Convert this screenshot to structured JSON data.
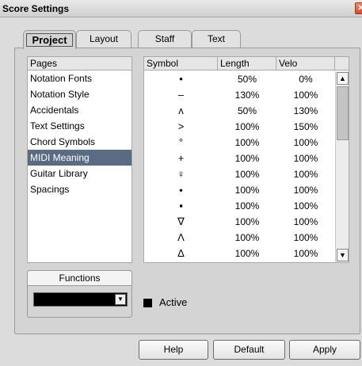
{
  "window": {
    "title": "Score Settings",
    "close_glyph": "✕"
  },
  "tabs": [
    {
      "label": "Project"
    },
    {
      "label": "Layout"
    },
    {
      "label": "Staff"
    },
    {
      "label": "Text"
    }
  ],
  "pages": {
    "header": "Pages",
    "items": [
      "Notation Fonts",
      "Notation Style",
      "Accidentals",
      "Text Settings",
      "Chord Symbols",
      "MIDI Meaning",
      "Guitar Library",
      "Spacings"
    ],
    "selected": "MIDI Meaning"
  },
  "table": {
    "headers": {
      "symbol": "Symbol",
      "length": "Length",
      "velo": "Velo"
    },
    "rows": [
      {
        "symbol": "•",
        "length": "50%",
        "velo": "0%"
      },
      {
        "symbol": "–",
        "length": "130%",
        "velo": "100%"
      },
      {
        "symbol": "ʌ",
        "length": "50%",
        "velo": "130%"
      },
      {
        "symbol": ">",
        "length": "100%",
        "velo": "150%"
      },
      {
        "symbol": "°",
        "length": "100%",
        "velo": "100%"
      },
      {
        "symbol": "+",
        "length": "100%",
        "velo": "100%"
      },
      {
        "symbol": "♀",
        "length": "100%",
        "velo": "100%"
      },
      {
        "symbol": "⬩",
        "length": "100%",
        "velo": "100%"
      },
      {
        "symbol": "▪",
        "length": "100%",
        "velo": "100%"
      },
      {
        "symbol": "∇",
        "length": "100%",
        "velo": "100%"
      },
      {
        "symbol": "Λ",
        "length": "100%",
        "velo": "100%"
      },
      {
        "symbol": "∆",
        "length": "100%",
        "velo": "100%"
      }
    ]
  },
  "scrollbar": {
    "up_glyph": "▲",
    "down_glyph": "▼"
  },
  "functions": {
    "label": "Functions",
    "selected_value": "",
    "arrow_glyph": "▼"
  },
  "active": {
    "label": "Active",
    "checked": true
  },
  "buttons": {
    "help": "Help",
    "default": "Default",
    "apply": "Apply"
  }
}
